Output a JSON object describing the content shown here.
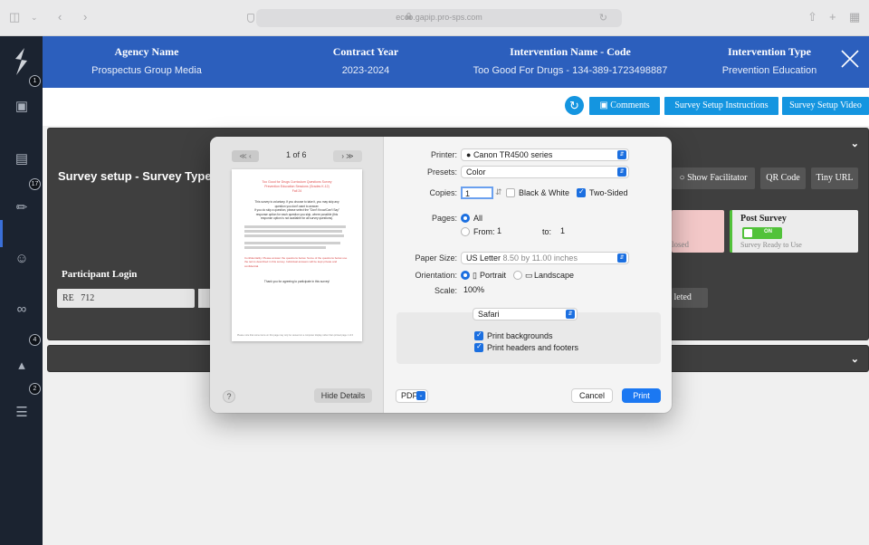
{
  "browser": {
    "url": "ecco.gapip.pro-sps.com"
  },
  "rail": {
    "badges": [
      "1",
      "17",
      "4",
      "2"
    ]
  },
  "header": {
    "columns": [
      {
        "label": "Agency Name",
        "value": "Prospectus Group Media"
      },
      {
        "label": "Contract Year",
        "value": "2023-2024"
      },
      {
        "label": "Intervention Name - Code",
        "value": "Too Good For Drugs - 134-389-1723498887"
      },
      {
        "label": "Intervention Type",
        "value": "Prevention Education"
      }
    ]
  },
  "toolbar": {
    "comments_label": "Comments",
    "instructions_label": "Survey Setup Instructions",
    "video_label": "Survey Setup Video"
  },
  "panel": {
    "title": "Survey setup - Survey Type :",
    "show_facilitator_label": "Show Facilitator",
    "qr_code_label": "QR Code",
    "tiny_url_label": "Tiny URL",
    "closed_text": "losed",
    "post_survey": {
      "title": "Post Survey",
      "toggle_text": "ON",
      "status": "Survey Ready to Use"
    },
    "completed_text": "leted",
    "participant_login_label": "Participant Login",
    "login_prefix": "RE",
    "login_value": "712"
  },
  "print_dialog": {
    "page_indicator": "1 of 6",
    "nav_prev": "≪ ‹",
    "nav_next": "› ≫",
    "preview": {
      "title_lines": [
        "Too Good for Drugs Curriculum Questions Survey",
        "Prevention Education Sessions (Grades K-12)",
        "Fall 24"
      ],
      "intro": [
        "This survey is voluntary. If you choose to take it, you may skip any",
        "question you don't want to answer.",
        "If you do skip a question, please select the \"Don't Know/Can't Say\"",
        "response option for each question you skip, where possible (this",
        "response option is not available for all survey questions)."
      ],
      "red_text": "Confidentiality: Please answer the questions below. Some of the questions below use the terms described in this survey. Individual answers will be kept private and confidential.",
      "thanks": "Thank you for agreeing to participate in this survey!",
      "footer": "Please note that some items on this page may only be viewed on a computer display rather than printed  page 1 of 6"
    },
    "printer_label": "Printer:",
    "printer_value": "Canon TR4500 series",
    "presets_label": "Presets:",
    "presets_value": "Color",
    "copies_label": "Copies:",
    "copies_value": "1",
    "bw_label": "Black & White",
    "two_sided_label": "Two-Sided",
    "pages_label": "Pages:",
    "pages_all": "All",
    "pages_from": "From:",
    "from_value": "1",
    "pages_to": "to:",
    "to_value": "1",
    "paper_size_label": "Paper Size:",
    "paper_size_value": "US Letter",
    "paper_size_detail": "8.50 by 11.00 inches",
    "orientation_label": "Orientation:",
    "portrait_label": "Portrait",
    "landscape_label": "Landscape",
    "scale_label": "Scale:",
    "scale_value": "100%",
    "app_select": "Safari",
    "print_backgrounds": "Print backgrounds",
    "print_headers": "Print headers and footers",
    "help_label": "?",
    "hide_details": "Hide Details",
    "pdf_label": "PDF",
    "cancel_label": "Cancel",
    "print_label": "Print"
  },
  "colors": {
    "header_blue": "#2c5fbd",
    "button_blue": "#1495e0",
    "rail_dark": "#1b2330",
    "panel_dark": "#3f3f3f",
    "toggle_green": "#52c23a",
    "macos_blue": "#1b6fe0"
  }
}
